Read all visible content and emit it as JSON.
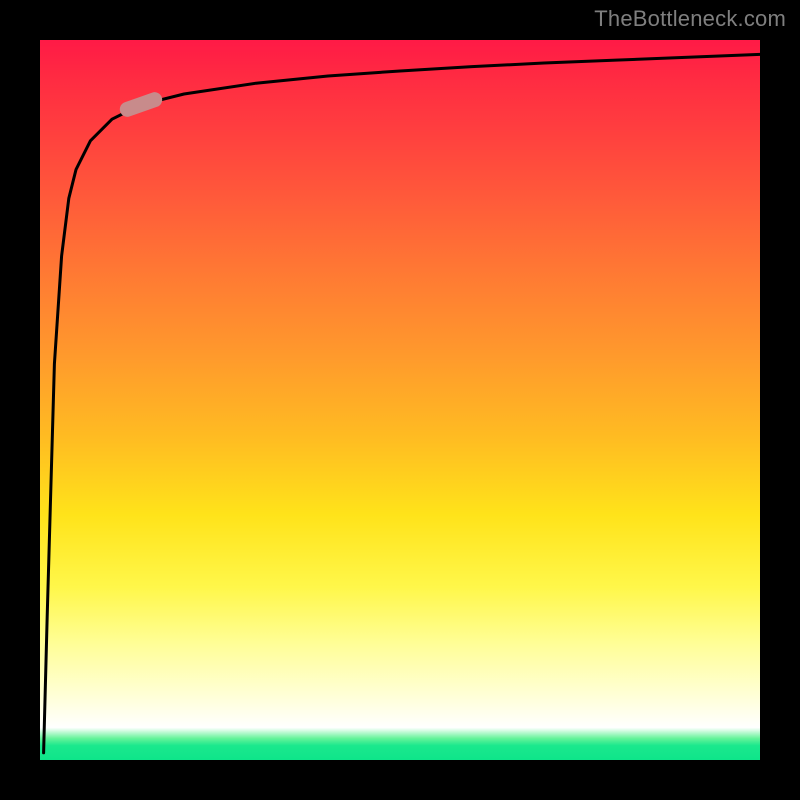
{
  "credit": "TheBottleneck.com",
  "chart_data": {
    "type": "line",
    "title": "",
    "xlabel": "",
    "ylabel": "",
    "xlim": [
      0,
      100
    ],
    "ylim": [
      0,
      100
    ],
    "grid": false,
    "legend": false,
    "x": [
      0.5,
      1,
      2,
      3,
      4,
      5,
      7,
      10,
      14,
      20,
      30,
      40,
      50,
      60,
      70,
      80,
      90,
      100
    ],
    "values": [
      1,
      20,
      55,
      70,
      78,
      82,
      86,
      89,
      91,
      92.5,
      94,
      95,
      95.7,
      96.3,
      96.8,
      97.2,
      97.6,
      98
    ],
    "marker": {
      "x": 14,
      "y": 91
    },
    "gradient_colors": {
      "top": "#ff1a46",
      "mid_upper": "#ff7b33",
      "mid": "#ffe31a",
      "mid_lower": "#ffffff",
      "bottom": "#0ee58a"
    }
  }
}
